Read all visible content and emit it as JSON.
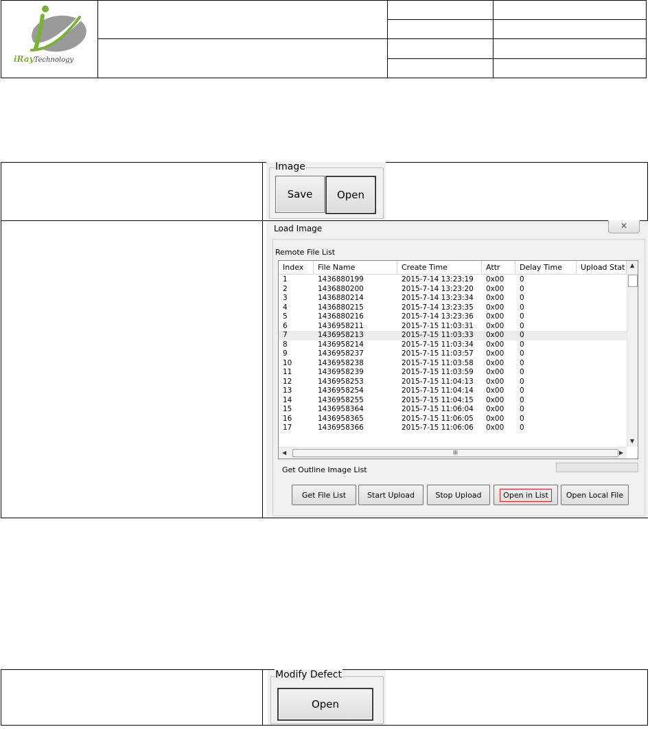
{
  "header": {
    "logo_text_main": "iRay",
    "logo_text_sub": "Technology"
  },
  "image_group": {
    "title": "Image",
    "save_label": "Save",
    "open_label": "Open"
  },
  "load_image_dialog": {
    "title": "Load Image",
    "close_glyph": "✕",
    "remote_file_list_label": "Remote File List",
    "columns": [
      "Index",
      "File Name",
      "Create Time",
      "Attr",
      "Delay Time",
      "Upload Stat"
    ],
    "rows": [
      [
        "1",
        "1436880199",
        "2015-7-14 13:23:19",
        "0x00",
        "0"
      ],
      [
        "2",
        "1436880200",
        "2015-7-14 13:23:20",
        "0x00",
        "0"
      ],
      [
        "3",
        "1436880214",
        "2015-7-14 13:23:34",
        "0x00",
        "0"
      ],
      [
        "4",
        "1436880215",
        "2015-7-14 13:23:35",
        "0x00",
        "0"
      ],
      [
        "5",
        "1436880216",
        "2015-7-14 13:23:36",
        "0x00",
        "0"
      ],
      [
        "6",
        "1436958211",
        "2015-7-15 11:03:31",
        "0x00",
        "0"
      ],
      [
        "7",
        "1436958213",
        "2015-7-15 11:03:33",
        "0x00",
        "0"
      ],
      [
        "8",
        "1436958214",
        "2015-7-15 11:03:34",
        "0x00",
        "0"
      ],
      [
        "9",
        "1436958237",
        "2015-7-15 11:03:57",
        "0x00",
        "0"
      ],
      [
        "10",
        "1436958238",
        "2015-7-15 11:03:58",
        "0x00",
        "0"
      ],
      [
        "11",
        "1436958239",
        "2015-7-15 11:03:59",
        "0x00",
        "0"
      ],
      [
        "12",
        "1436958253",
        "2015-7-15 11:04:13",
        "0x00",
        "0"
      ],
      [
        "13",
        "1436958254",
        "2015-7-15 11:04:14",
        "0x00",
        "0"
      ],
      [
        "14",
        "1436958255",
        "2015-7-15 11:04:15",
        "0x00",
        "0"
      ],
      [
        "15",
        "1436958364",
        "2015-7-15 11:06:04",
        "0x00",
        "0"
      ],
      [
        "16",
        "1436958365",
        "2015-7-15 11:06:05",
        "0x00",
        "0"
      ],
      [
        "17",
        "1436958366",
        "2015-7-15 11:06:06",
        "0x00",
        "0"
      ]
    ],
    "highlighted_row": 7,
    "scroll_thumb_label": "III",
    "outline_label": "Get Outline Image List",
    "buttons": {
      "get_file_list": "Get File List",
      "start_upload": "Start Upload",
      "stop_upload": "Stop Upload",
      "open_in_list": "Open in List",
      "open_local_file": "Open Local File"
    }
  },
  "modify_defect_group": {
    "title": "Modify Defect",
    "open_label": "Open"
  },
  "colors": {
    "logo_green": "#7ab236",
    "logo_gray": "#9a9a9a",
    "focus_red": "#e02020"
  }
}
